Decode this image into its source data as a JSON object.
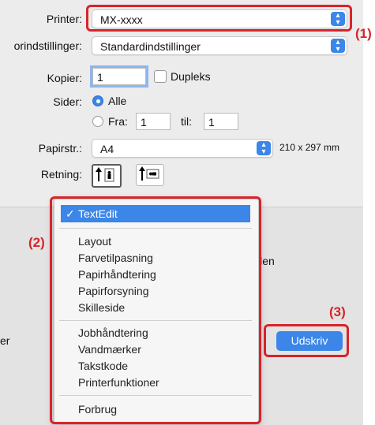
{
  "printer": {
    "label": "Printer:",
    "value": "MX-xxxx"
  },
  "presets": {
    "label": "orindstillinger:",
    "value": "Standardindstillinger"
  },
  "copies": {
    "label": "Kopier:",
    "value": "1",
    "duplex_label": "Dupleks"
  },
  "pages": {
    "label": "Sider:",
    "all_label": "Alle",
    "from_label": "Fra:",
    "from_value": "1",
    "to_label": "til:",
    "to_value": "1"
  },
  "paper": {
    "label": "Papirstr.:",
    "value": "A4",
    "dimensions": "210 x 297 mm"
  },
  "orientation": {
    "label": "Retning:"
  },
  "menu": {
    "selected": "TextEdit",
    "group1": [
      "Layout",
      "Farvetilpasning",
      "Papirhåndtering",
      "Papirforsyning",
      "Skilleside"
    ],
    "group2": [
      "Jobhåndtering",
      "Vandmærker",
      "Takstkode",
      "Printerfunktioner"
    ],
    "group3": [
      "Forbrug"
    ]
  },
  "partial_text": {
    "behind_menu": "ilen",
    "left_cut": "er"
  },
  "buttons": {
    "print": "Udskriv"
  },
  "callouts": {
    "c1": "(1)",
    "c2": "(2)",
    "c3": "(3)"
  },
  "colors": {
    "accent": "#3b86e8",
    "callout_red": "#d8232a"
  }
}
